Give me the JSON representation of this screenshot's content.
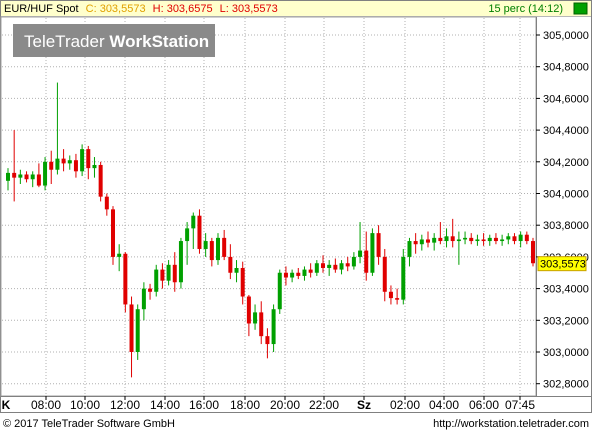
{
  "header": {
    "symbol": "EUR/HUF Spot",
    "close_label": "C: 303,5573",
    "high_label": "H: 303,6575",
    "low_label": "L: 303,5573",
    "period_label": "15 perc (14:12)"
  },
  "watermark": {
    "prefix": "TeleTrader",
    "suffix": "WorkStation"
  },
  "footer": {
    "copyright": "© 2017  TeleTrader Software GmbH",
    "url": "http://workstation.teletrader.com"
  },
  "colors": {
    "up": "#00a000",
    "down": "#e00000",
    "header_bg": "#ffffcc",
    "grid": "#b0b0b0",
    "price_tag": "#ffff00"
  },
  "chart_data": {
    "type": "candlestick",
    "interval": "15 perc",
    "ylim": [
      302.7,
      305.15
    ],
    "y_ticks": [
      "305,0000",
      "304,8000",
      "304,6000",
      "304,4000",
      "304,2000",
      "304,0000",
      "303,8000",
      "303,6000",
      "303,4000",
      "303,2000",
      "303,0000",
      "302,8000"
    ],
    "x_ticks": [
      "K",
      "08:00",
      "10:00",
      "12:00",
      "14:00",
      "16:00",
      "18:00",
      "20:00",
      "22:00",
      "Sz",
      "02:00",
      "04:00",
      "06:00",
      "07:45"
    ],
    "last_value_label": "303,5573",
    "last_value": 303.5573,
    "candles": [
      [
        304.08,
        304.16,
        304.02,
        304.13
      ],
      [
        304.13,
        304.4,
        303.95,
        304.1
      ],
      [
        304.1,
        304.15,
        304.06,
        304.12
      ],
      [
        304.12,
        304.14,
        304.07,
        304.09
      ],
      [
        304.09,
        304.14,
        304.04,
        304.12
      ],
      [
        304.12,
        304.19,
        304.04,
        304.05
      ],
      [
        304.05,
        304.23,
        304.02,
        304.2
      ],
      [
        304.2,
        304.27,
        304.06,
        304.15
      ],
      [
        304.15,
        304.7,
        304.12,
        304.22
      ],
      [
        304.22,
        304.28,
        304.14,
        304.19
      ],
      [
        304.19,
        304.24,
        304.15,
        304.21
      ],
      [
        304.21,
        304.25,
        304.1,
        304.14
      ],
      [
        304.14,
        304.31,
        304.11,
        304.28
      ],
      [
        304.28,
        304.3,
        304.09,
        304.16
      ],
      [
        304.16,
        304.23,
        304.1,
        304.18
      ],
      [
        304.18,
        304.2,
        303.95,
        303.98
      ],
      [
        303.98,
        304.0,
        303.86,
        303.9
      ],
      [
        303.9,
        303.92,
        303.55,
        303.6
      ],
      [
        303.6,
        303.68,
        303.51,
        303.62
      ],
      [
        303.62,
        303.63,
        303.25,
        303.3
      ],
      [
        303.3,
        303.35,
        302.84,
        303.0
      ],
      [
        303.0,
        303.3,
        302.95,
        303.27
      ],
      [
        303.27,
        303.44,
        303.2,
        303.4
      ],
      [
        303.4,
        303.43,
        303.33,
        303.38
      ],
      [
        303.38,
        303.55,
        303.35,
        303.52
      ],
      [
        303.52,
        303.56,
        303.4,
        303.45
      ],
      [
        303.45,
        303.58,
        303.42,
        303.55
      ],
      [
        303.55,
        303.63,
        303.38,
        303.44
      ],
      [
        303.44,
        303.72,
        303.4,
        303.7
      ],
      [
        303.7,
        303.82,
        303.55,
        303.78
      ],
      [
        303.78,
        303.88,
        303.65,
        303.86
      ],
      [
        303.86,
        303.9,
        303.62,
        303.65
      ],
      [
        303.65,
        303.75,
        303.6,
        303.7
      ],
      [
        303.7,
        303.72,
        303.54,
        303.58
      ],
      [
        303.58,
        303.75,
        303.55,
        303.72
      ],
      [
        303.72,
        303.77,
        303.58,
        303.6
      ],
      [
        303.6,
        303.68,
        303.46,
        303.5
      ],
      [
        303.5,
        303.58,
        303.44,
        303.53
      ],
      [
        303.53,
        303.57,
        303.3,
        303.35
      ],
      [
        303.35,
        303.36,
        303.1,
        303.18
      ],
      [
        303.18,
        303.3,
        303.14,
        303.25
      ],
      [
        303.25,
        303.32,
        303.05,
        303.1
      ],
      [
        303.1,
        303.15,
        302.96,
        303.05
      ],
      [
        303.05,
        303.3,
        303.0,
        303.27
      ],
      [
        303.27,
        303.52,
        303.24,
        303.5
      ],
      [
        303.5,
        303.54,
        303.42,
        303.47
      ],
      [
        303.47,
        303.52,
        303.44,
        303.5
      ],
      [
        303.5,
        303.53,
        303.46,
        303.48
      ],
      [
        303.48,
        303.54,
        303.45,
        303.52
      ],
      [
        303.52,
        303.56,
        303.47,
        303.5
      ],
      [
        303.5,
        303.58,
        303.48,
        303.56
      ],
      [
        303.56,
        303.61,
        303.5,
        303.53
      ],
      [
        303.53,
        303.58,
        303.48,
        303.55
      ],
      [
        303.55,
        303.59,
        303.5,
        303.52
      ],
      [
        303.52,
        303.58,
        303.49,
        303.56
      ],
      [
        303.56,
        303.6,
        303.51,
        303.54
      ],
      [
        303.54,
        303.63,
        303.52,
        303.6
      ],
      [
        303.6,
        303.82,
        303.56,
        303.64
      ],
      [
        303.64,
        303.76,
        303.45,
        303.5
      ],
      [
        303.5,
        303.78,
        303.48,
        303.75
      ],
      [
        303.75,
        303.8,
        303.55,
        303.6
      ],
      [
        303.6,
        303.65,
        303.32,
        303.38
      ],
      [
        303.38,
        303.42,
        303.3,
        303.34
      ],
      [
        303.34,
        303.4,
        303.3,
        303.33
      ],
      [
        303.33,
        303.65,
        303.3,
        303.6
      ],
      [
        303.6,
        303.72,
        303.54,
        303.7
      ],
      [
        303.7,
        303.75,
        303.62,
        303.68
      ],
      [
        303.68,
        303.74,
        303.64,
        303.71
      ],
      [
        303.71,
        303.76,
        303.66,
        303.69
      ],
      [
        303.69,
        303.75,
        303.64,
        303.72
      ],
      [
        303.72,
        303.82,
        303.68,
        303.7
      ],
      [
        303.7,
        303.78,
        303.66,
        303.73
      ],
      [
        303.73,
        303.84,
        303.66,
        303.7
      ],
      [
        303.7,
        303.76,
        303.55,
        303.71
      ],
      [
        303.71,
        303.76,
        303.68,
        303.72
      ],
      [
        303.72,
        303.75,
        303.68,
        303.7
      ],
      [
        303.7,
        303.74,
        303.67,
        303.71
      ],
      [
        303.71,
        303.75,
        303.67,
        303.7
      ],
      [
        303.7,
        303.74,
        303.67,
        303.72
      ],
      [
        303.72,
        303.75,
        303.68,
        303.7
      ],
      [
        303.7,
        303.74,
        303.67,
        303.71
      ],
      [
        303.71,
        303.75,
        303.68,
        303.73
      ],
      [
        303.73,
        303.75,
        303.68,
        303.7
      ],
      [
        303.7,
        303.76,
        303.66,
        303.74
      ],
      [
        303.74,
        303.76,
        303.68,
        303.7
      ],
      [
        303.7,
        303.72,
        303.54,
        303.56
      ]
    ]
  }
}
